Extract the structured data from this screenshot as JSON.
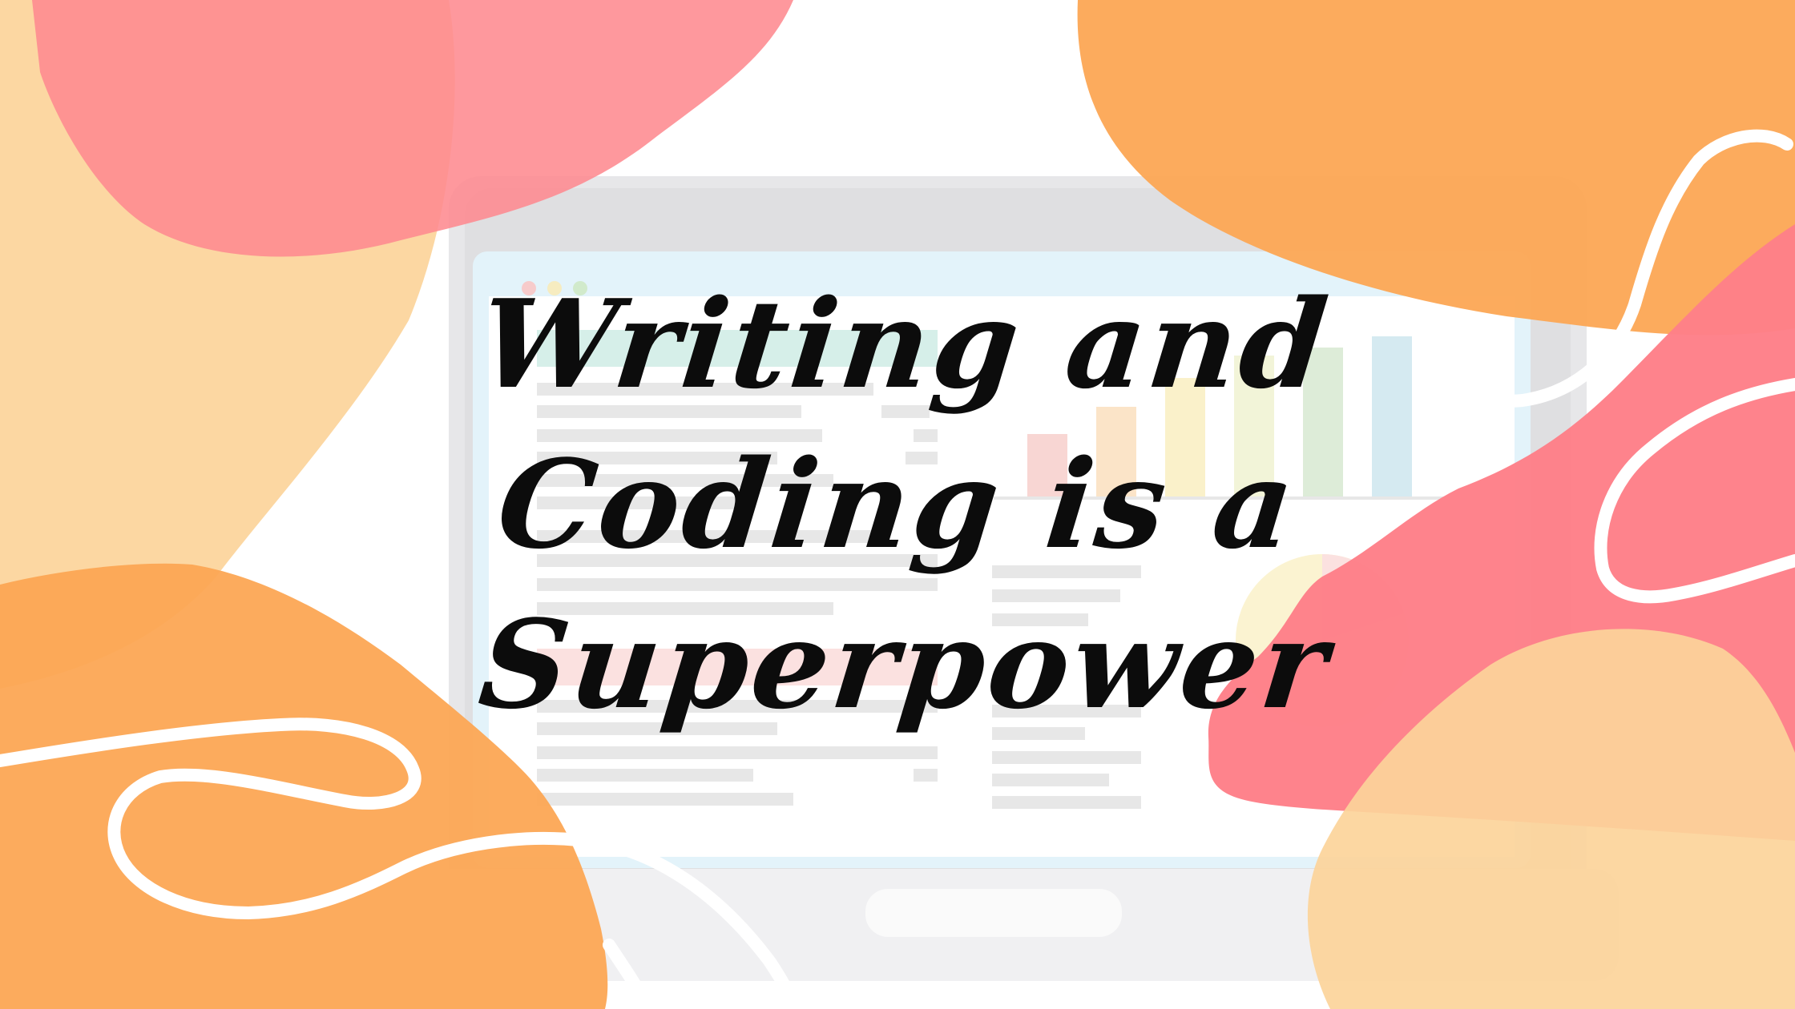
{
  "headline": {
    "lines": [
      "Writing and",
      "Coding is a",
      "Superpower"
    ]
  },
  "illustration": {
    "subject": "laptop-with-dashboard",
    "window_dots": [
      "#f7c9c9",
      "#f6ebbd",
      "#cfe9c9"
    ],
    "bar_colors": [
      "#f8d4d1",
      "#fbe3c6",
      "#faf1c8",
      "#f2f4d6",
      "#dcebd6",
      "#d3e9f1"
    ]
  },
  "palette": {
    "peach": "#fcd49a",
    "pink": "#fe8a90",
    "orange": "#fca654",
    "coral": "#fe7f88",
    "white_stroke": "#ffffff",
    "text": "#0c0c0c"
  }
}
